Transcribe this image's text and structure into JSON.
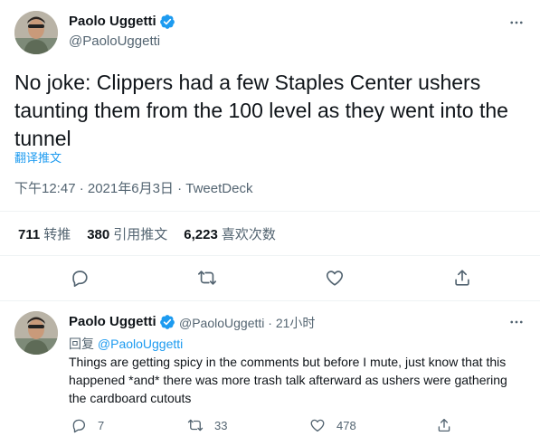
{
  "main_tweet": {
    "author_name": "Paolo Uggetti",
    "author_handle": "@PaoloUggetti",
    "text": "No joke: Clippers had a few Staples Center ushers taunting them from the 100 level as they went into the tunnel",
    "translate_label": "翻译推文",
    "timestamp": "下午12:47 · 2021年6月3日",
    "separator": " · ",
    "source": "TweetDeck",
    "stats": [
      {
        "count": "711",
        "label": "转推"
      },
      {
        "count": "380",
        "label": "引用推文"
      },
      {
        "count": "6,223",
        "label": "喜欢次数"
      }
    ]
  },
  "reply_tweet": {
    "author_name": "Paolo Uggetti",
    "author_handle": "@PaoloUggetti",
    "time": "· 21小时",
    "replying_prefix": "回复",
    "replying_to": "@PaoloUggetti",
    "text": "Things are getting spicy in the comments but before I mute, just know that this happened *and* there was more trash talk afterward as ushers were gathering the cardboard cutouts",
    "reply_count": "7",
    "retweet_count": "33",
    "like_count": "478"
  },
  "colors": {
    "verified": "#1d9bf0",
    "link": "#1d9bf0",
    "secondary_text": "#536471",
    "divider": "#eff3f4"
  },
  "icons": [
    "verified-badge-icon",
    "more-icon",
    "reply-icon",
    "retweet-icon",
    "like-icon",
    "share-icon"
  ]
}
